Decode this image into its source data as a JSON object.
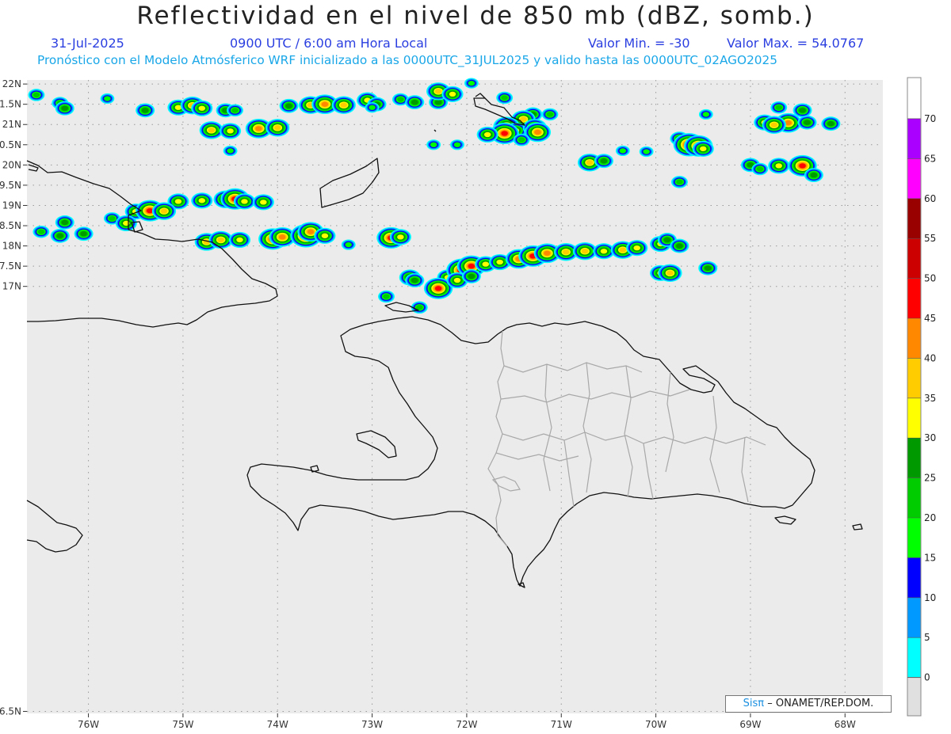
{
  "header": {
    "title": "Reflectividad en el nivel de 850 mb (dBZ, somb.)",
    "date": "31-Jul-2025",
    "time": "0900 UTC / 6:00 am Hora Local",
    "min": "Valor Min. = -30",
    "max": "Valor Max. = 54.0767",
    "forecast": "Pronóstico con el Modelo Atmósferico WRF inicializado a las 0000UTC_31JUL2025 y valido hasta las  0000UTC_02AGO2025"
  },
  "map": {
    "lon_range": [
      -76.65,
      -67.6
    ],
    "lat_range": [
      6.45,
      22.1
    ],
    "lat_ticks": [
      {
        "value": 22,
        "label": "22N"
      },
      {
        "value": 21.5,
        "label": "1.5N"
      },
      {
        "value": 21,
        "label": "21N"
      },
      {
        "value": 20.5,
        "label": "0.5N"
      },
      {
        "value": 20,
        "label": "20N"
      },
      {
        "value": 19.5,
        "label": "9.5N"
      },
      {
        "value": 19,
        "label": "19N"
      },
      {
        "value": 18.5,
        "label": "8.5N"
      },
      {
        "value": 18,
        "label": "18N"
      },
      {
        "value": 17.5,
        "label": "7.5N"
      },
      {
        "value": 17,
        "label": "17N"
      },
      {
        "value": 6.5,
        "label": "6.5N"
      }
    ],
    "lon_ticks": [
      {
        "value": -76,
        "label": "76W"
      },
      {
        "value": -75,
        "label": "75W"
      },
      {
        "value": -74,
        "label": "74W"
      },
      {
        "value": -73,
        "label": "73W"
      },
      {
        "value": -72,
        "label": "72W"
      },
      {
        "value": -71,
        "label": "71W"
      },
      {
        "value": -70,
        "label": "70W"
      },
      {
        "value": -69,
        "label": "69W"
      },
      {
        "value": -68,
        "label": "68W"
      }
    ],
    "background_color": "#ebebeb",
    "coast_color": "#111111",
    "border_color": "#a8a8a8"
  },
  "colorbar": {
    "levels": [
      {
        "value": 0,
        "label": "0",
        "color": "#00ffff"
      },
      {
        "value": 5,
        "label": "5",
        "color": "#0099ff"
      },
      {
        "value": 10,
        "label": "10",
        "color": "#0000ff"
      },
      {
        "value": 15,
        "label": "15",
        "color": "#00ff00"
      },
      {
        "value": 20,
        "label": "20",
        "color": "#00cc00"
      },
      {
        "value": 25,
        "label": "25",
        "color": "#009900"
      },
      {
        "value": 30,
        "label": "30",
        "color": "#ffff00"
      },
      {
        "value": 35,
        "label": "35",
        "color": "#ffcc00"
      },
      {
        "value": 40,
        "label": "40",
        "color": "#ff8800"
      },
      {
        "value": 45,
        "label": "45",
        "color": "#ff0000"
      },
      {
        "value": 50,
        "label": "50",
        "color": "#cc0000"
      },
      {
        "value": 55,
        "label": "55",
        "color": "#990000"
      },
      {
        "value": 60,
        "label": "60",
        "color": "#ff00ff"
      },
      {
        "value": 65,
        "label": "65",
        "color": "#aa00ff"
      },
      {
        "value": 70,
        "label": "70",
        "color": ""
      }
    ],
    "below_color": "#e0e0e0",
    "above_color": "#ffffff"
  },
  "cells": [
    {
      "lon": -76.55,
      "lat": 21.73,
      "dbz": 20
    },
    {
      "lon": -76.3,
      "lat": 21.53,
      "dbz": 20
    },
    {
      "lon": -76.25,
      "lat": 21.4,
      "dbz": 25
    },
    {
      "lon": -75.8,
      "lat": 21.64,
      "dbz": 15
    },
    {
      "lon": -75.4,
      "lat": 21.35,
      "dbz": 25
    },
    {
      "lon": -75.05,
      "lat": 21.42,
      "dbz": 30
    },
    {
      "lon": -74.9,
      "lat": 21.47,
      "dbz": 35
    },
    {
      "lon": -74.8,
      "lat": 21.4,
      "dbz": 30
    },
    {
      "lon": -74.55,
      "lat": 21.35,
      "dbz": 25
    },
    {
      "lon": -74.45,
      "lat": 21.35,
      "dbz": 20
    },
    {
      "lon": -74.7,
      "lat": 20.86,
      "dbz": 35
    },
    {
      "lon": -74.5,
      "lat": 20.84,
      "dbz": 30
    },
    {
      "lon": -74.2,
      "lat": 20.9,
      "dbz": 40
    },
    {
      "lon": -74.0,
      "lat": 20.92,
      "dbz": 35
    },
    {
      "lon": -73.88,
      "lat": 21.46,
      "dbz": 25
    },
    {
      "lon": -73.65,
      "lat": 21.48,
      "dbz": 35
    },
    {
      "lon": -73.5,
      "lat": 21.5,
      "dbz": 40
    },
    {
      "lon": -73.3,
      "lat": 21.48,
      "dbz": 35
    },
    {
      "lon": -73.05,
      "lat": 21.6,
      "dbz": 30
    },
    {
      "lon": -72.95,
      "lat": 21.5,
      "dbz": 25
    },
    {
      "lon": -72.7,
      "lat": 21.62,
      "dbz": 20
    },
    {
      "lon": -72.55,
      "lat": 21.55,
      "dbz": 25
    },
    {
      "lon": -72.3,
      "lat": 21.55,
      "dbz": 25
    },
    {
      "lon": -72.3,
      "lat": 21.82,
      "dbz": 35
    },
    {
      "lon": -72.15,
      "lat": 21.75,
      "dbz": 30
    },
    {
      "lon": -71.95,
      "lat": 22.02,
      "dbz": 15
    },
    {
      "lon": -71.6,
      "lat": 21.66,
      "dbz": 20
    },
    {
      "lon": -71.3,
      "lat": 21.25,
      "dbz": 25
    },
    {
      "lon": -71.12,
      "lat": 21.25,
      "dbz": 20
    },
    {
      "lon": -71.4,
      "lat": 21.13,
      "dbz": 35
    },
    {
      "lon": -71.58,
      "lat": 20.95,
      "dbz": 40
    },
    {
      "lon": -71.48,
      "lat": 20.85,
      "dbz": 30
    },
    {
      "lon": -71.28,
      "lat": 20.92,
      "dbz": 35
    },
    {
      "lon": -71.25,
      "lat": 20.81,
      "dbz": 40
    },
    {
      "lon": -71.6,
      "lat": 20.78,
      "dbz": 45
    },
    {
      "lon": -71.78,
      "lat": 20.75,
      "dbz": 30
    },
    {
      "lon": -71.42,
      "lat": 20.62,
      "dbz": 20
    },
    {
      "lon": -72.35,
      "lat": 20.5,
      "dbz": 15
    },
    {
      "lon": -72.1,
      "lat": 20.5,
      "dbz": 15
    },
    {
      "lon": -69.75,
      "lat": 20.65,
      "dbz": 25
    },
    {
      "lon": -69.65,
      "lat": 20.5,
      "dbz": 50
    },
    {
      "lon": -69.55,
      "lat": 20.47,
      "dbz": 45
    },
    {
      "lon": -69.5,
      "lat": 20.4,
      "dbz": 30
    },
    {
      "lon": -70.35,
      "lat": 20.35,
      "dbz": 15
    },
    {
      "lon": -70.1,
      "lat": 20.33,
      "dbz": 15
    },
    {
      "lon": -69.47,
      "lat": 21.25,
      "dbz": 15
    },
    {
      "lon": -68.85,
      "lat": 21.05,
      "dbz": 30
    },
    {
      "lon": -68.6,
      "lat": 21.04,
      "dbz": 40
    },
    {
      "lon": -68.75,
      "lat": 20.99,
      "dbz": 35
    },
    {
      "lon": -68.4,
      "lat": 21.05,
      "dbz": 25
    },
    {
      "lon": -68.15,
      "lat": 21.02,
      "dbz": 25
    },
    {
      "lon": -68.45,
      "lat": 21.35,
      "dbz": 25
    },
    {
      "lon": -68.7,
      "lat": 21.42,
      "dbz": 20
    },
    {
      "lon": -70.7,
      "lat": 20.06,
      "dbz": 35
    },
    {
      "lon": -70.55,
      "lat": 20.1,
      "dbz": 25
    },
    {
      "lon": -69.0,
      "lat": 20.0,
      "dbz": 25
    },
    {
      "lon": -68.9,
      "lat": 19.9,
      "dbz": 20
    },
    {
      "lon": -68.7,
      "lat": 19.98,
      "dbz": 30
    },
    {
      "lon": -68.45,
      "lat": 19.98,
      "dbz": 45
    },
    {
      "lon": -68.33,
      "lat": 19.75,
      "dbz": 25
    },
    {
      "lon": -69.75,
      "lat": 19.58,
      "dbz": 20
    },
    {
      "lon": -75.05,
      "lat": 19.1,
      "dbz": 30
    },
    {
      "lon": -74.8,
      "lat": 19.12,
      "dbz": 30
    },
    {
      "lon": -74.55,
      "lat": 19.15,
      "dbz": 35
    },
    {
      "lon": -74.45,
      "lat": 19.16,
      "dbz": 45
    },
    {
      "lon": -74.35,
      "lat": 19.1,
      "dbz": 30
    },
    {
      "lon": -74.15,
      "lat": 19.08,
      "dbz": 30
    },
    {
      "lon": -75.5,
      "lat": 18.85,
      "dbz": 30
    },
    {
      "lon": -75.35,
      "lat": 18.87,
      "dbz": 45
    },
    {
      "lon": -75.2,
      "lat": 18.86,
      "dbz": 35
    },
    {
      "lon": -75.75,
      "lat": 18.68,
      "dbz": 20
    },
    {
      "lon": -76.25,
      "lat": 18.58,
      "dbz": 25
    },
    {
      "lon": -75.6,
      "lat": 18.56,
      "dbz": 30
    },
    {
      "lon": -76.5,
      "lat": 18.35,
      "dbz": 20
    },
    {
      "lon": -76.3,
      "lat": 18.25,
      "dbz": 25
    },
    {
      "lon": -76.05,
      "lat": 18.3,
      "dbz": 25
    },
    {
      "lon": -74.75,
      "lat": 18.1,
      "dbz": 35
    },
    {
      "lon": -74.6,
      "lat": 18.15,
      "dbz": 35
    },
    {
      "lon": -74.4,
      "lat": 18.15,
      "dbz": 30
    },
    {
      "lon": -74.05,
      "lat": 18.17,
      "dbz": 45
    },
    {
      "lon": -73.95,
      "lat": 18.22,
      "dbz": 40
    },
    {
      "lon": -73.7,
      "lat": 18.25,
      "dbz": 50
    },
    {
      "lon": -73.65,
      "lat": 18.35,
      "dbz": 40
    },
    {
      "lon": -73.5,
      "lat": 18.25,
      "dbz": 30
    },
    {
      "lon": -72.8,
      "lat": 18.2,
      "dbz": 45
    },
    {
      "lon": -72.7,
      "lat": 18.22,
      "dbz": 30
    },
    {
      "lon": -73.25,
      "lat": 18.03,
      "dbz": 15
    },
    {
      "lon": -72.2,
      "lat": 17.22,
      "dbz": 30
    },
    {
      "lon": -72.05,
      "lat": 17.4,
      "dbz": 50
    },
    {
      "lon": -71.95,
      "lat": 17.5,
      "dbz": 45
    },
    {
      "lon": -71.8,
      "lat": 17.55,
      "dbz": 30
    },
    {
      "lon": -71.65,
      "lat": 17.6,
      "dbz": 30
    },
    {
      "lon": -71.45,
      "lat": 17.68,
      "dbz": 40
    },
    {
      "lon": -71.3,
      "lat": 17.75,
      "dbz": 45
    },
    {
      "lon": -71.15,
      "lat": 17.82,
      "dbz": 40
    },
    {
      "lon": -70.95,
      "lat": 17.85,
      "dbz": 35
    },
    {
      "lon": -70.75,
      "lat": 17.87,
      "dbz": 35
    },
    {
      "lon": -70.55,
      "lat": 17.87,
      "dbz": 30
    },
    {
      "lon": -70.35,
      "lat": 17.9,
      "dbz": 35
    },
    {
      "lon": -70.2,
      "lat": 17.95,
      "dbz": 30
    },
    {
      "lon": -69.95,
      "lat": 18.05,
      "dbz": 30
    },
    {
      "lon": -69.88,
      "lat": 18.15,
      "dbz": 25
    },
    {
      "lon": -69.75,
      "lat": 18.0,
      "dbz": 25
    },
    {
      "lon": -69.45,
      "lat": 17.45,
      "dbz": 25
    },
    {
      "lon": -69.95,
      "lat": 17.33,
      "dbz": 30
    },
    {
      "lon": -69.85,
      "lat": 17.33,
      "dbz": 35
    },
    {
      "lon": -72.6,
      "lat": 17.22,
      "dbz": 30
    },
    {
      "lon": -72.55,
      "lat": 17.15,
      "dbz": 25
    },
    {
      "lon": -72.3,
      "lat": 16.95,
      "dbz": 45
    },
    {
      "lon": -72.1,
      "lat": 17.15,
      "dbz": 30
    },
    {
      "lon": -71.95,
      "lat": 17.25,
      "dbz": 25
    },
    {
      "lon": -72.85,
      "lat": 16.75,
      "dbz": 20
    },
    {
      "lon": -72.5,
      "lat": 16.48,
      "dbz": 20
    },
    {
      "lon": -73.0,
      "lat": 21.42,
      "dbz": 15
    },
    {
      "lon": -74.5,
      "lat": 20.35,
      "dbz": 15
    }
  ],
  "credit": {
    "logo": "Sisπ",
    "text": "– ONAMET/REP.DOM."
  }
}
